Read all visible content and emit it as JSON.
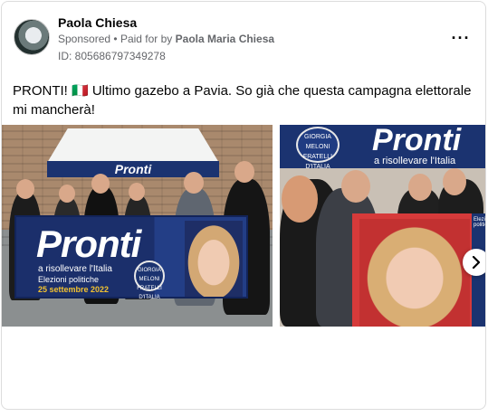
{
  "post": {
    "author": "Paola Chiesa",
    "sponsored": "Sponsored",
    "separator": "•",
    "paid_for_prefix": "Paid for by",
    "paid_for_name": "Paola Maria Chiesa",
    "library_id": "ID: 805686797349278",
    "caption": "PRONTI! 🇮🇹 Ultimo gazebo a Pavia. So già che questa campagna elettorale mi mancherà!",
    "more_icon": "more-options-icon",
    "next_icon": "chevron-right-icon"
  },
  "carousel": {
    "image1": {
      "tent_text": "Pronti",
      "banner_title": "Pronti",
      "banner_sub": "a risollevare l'Italia",
      "banner_line1": "Elezioni politiche",
      "banner_line2": "25 settembre 2022",
      "logo_text": "GIORGIA MELONI FRATELLI D'ITALIA"
    },
    "image2": {
      "banner_title": "Pronti",
      "banner_sub": "a risollevare l'Italia",
      "logo_text": "GIORGIA MELONI FRATELLI D'ITALIA",
      "side_text": "Elezioni politiche"
    }
  },
  "colors": {
    "party_blue": "#1b3370",
    "accent_yellow": "#f2c230",
    "secondary_text": "#65676b"
  }
}
